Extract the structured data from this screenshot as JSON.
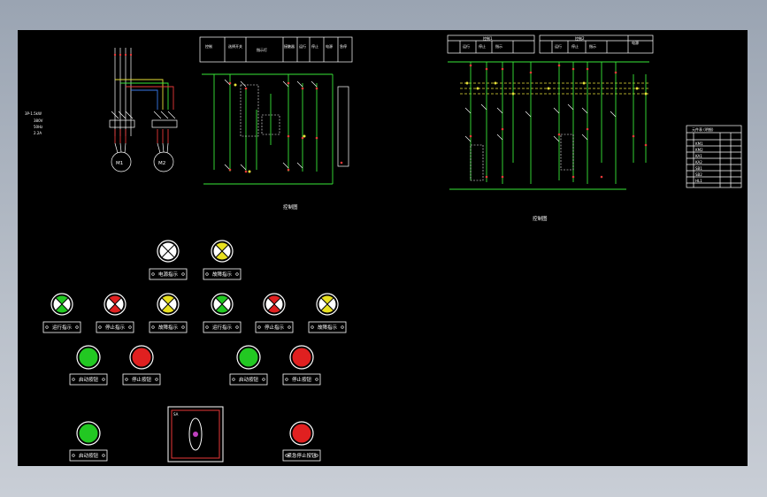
{
  "schematic_left": {
    "title_blocks": [
      "控制",
      "选择开关",
      "指示灯",
      "接触器",
      "运行",
      "停止",
      "电源",
      "急停"
    ],
    "motor_labels": [
      "M1",
      "M2"
    ],
    "caption": "控制图",
    "note_lines": [
      "3P-1.5kW",
      "380V",
      "50Hz",
      "2.2A"
    ]
  },
  "schematic_right": {
    "header_left": "控制1",
    "header_right": "控制2",
    "sub_headers": [
      "运行",
      "停止",
      "指示",
      "运行",
      "停止",
      "指示",
      "电源"
    ],
    "caption": "控制图",
    "table_title": "元件表 (明细)",
    "table_rows": [
      "KM1",
      "KM2",
      "KA1",
      "KA2",
      "SB1",
      "SB2",
      "HL1"
    ]
  },
  "panel": {
    "indicators": [
      {
        "color": "white",
        "label": "电源指示"
      },
      {
        "color": "yellow",
        "label": "故障指示"
      },
      {
        "color": "green",
        "label": "运行指示"
      },
      {
        "color": "red",
        "label": "停止指示"
      },
      {
        "color": "yellow",
        "label": "故障指示"
      },
      {
        "color": "green",
        "label": "运行指示"
      },
      {
        "color": "red",
        "label": "停止指示"
      },
      {
        "color": "yellow",
        "label": "故障指示"
      }
    ],
    "buttons": [
      {
        "color": "green",
        "label": "启动按钮"
      },
      {
        "color": "red",
        "label": "停止按钮"
      },
      {
        "color": "green",
        "label": "启动按钮"
      },
      {
        "color": "red",
        "label": "停止按钮"
      },
      {
        "color": "green",
        "label": "启动按钮"
      },
      {
        "color": "red",
        "label": "紧急停止按钮"
      }
    ],
    "selector_label": "SA"
  },
  "colors": {
    "background": "#000000",
    "wire_green": "#38e838",
    "wire_yellow": "#e8e038",
    "wire_red": "#e83838",
    "wire_blue": "#3878e8",
    "lamp_green": "#22c822",
    "lamp_red": "#e02020",
    "lamp_yellow": "#e8e020"
  }
}
